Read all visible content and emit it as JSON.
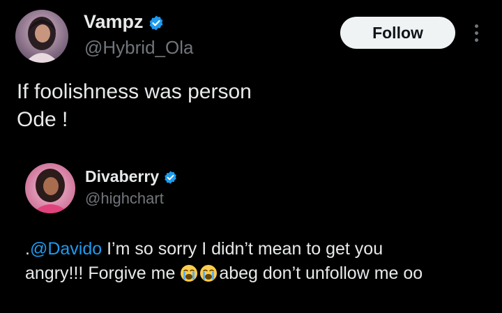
{
  "tweet": {
    "author": {
      "name": "Vampz",
      "handle": "@Hybrid_Ola",
      "verified": true,
      "avatar_icon": "profile-photo"
    },
    "follow_label": "Follow",
    "more_icon": "more-options-icon",
    "text_lines": [
      "If foolishness was person",
      "Ode !"
    ]
  },
  "quoted_tweet": {
    "author": {
      "name": "Divaberry",
      "handle": "@highchart",
      "verified": true,
      "avatar_icon": "profile-photo"
    },
    "text": {
      "prefix": ".",
      "mention": "@Davido",
      "line1_rest": " I’m so sorry I didn’t mean to get you",
      "line2_start": "angry!!! Forgive me ",
      "emoji": "loudly-crying-face",
      "emoji_count": 2,
      "line2_end": "abeg don’t unfollow me oo"
    }
  },
  "colors": {
    "background": "#000000",
    "text": "#e7e9ea",
    "secondary": "#71767b",
    "accent": "#1d9bf0",
    "button_bg": "#eff3f4"
  }
}
